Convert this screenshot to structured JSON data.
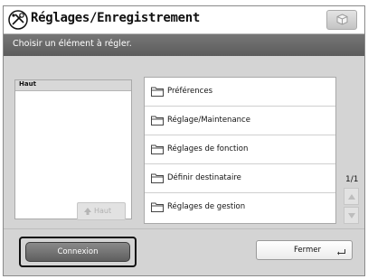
{
  "header": {
    "title": "Réglages/Enregistrement",
    "app_icon": "settings-tools-icon",
    "corner_icon": "cube-icon"
  },
  "instruction": "Choisir un élément à régler.",
  "tree": {
    "header_label": "Haut",
    "up_button_label": "Haut"
  },
  "list": {
    "items": [
      {
        "label": "Préférences",
        "icon": "folder-icon"
      },
      {
        "label": "Réglage/Maintenance",
        "icon": "folder-icon"
      },
      {
        "label": "Réglages de fonction",
        "icon": "folder-icon"
      },
      {
        "label": "Définir destinataire",
        "icon": "folder-icon"
      },
      {
        "label": "Réglages de gestion",
        "icon": "folder-icon"
      }
    ]
  },
  "pagination": {
    "text": "1/1"
  },
  "footer": {
    "connexion_label": "Connexion",
    "fermer_label": "Fermer"
  }
}
